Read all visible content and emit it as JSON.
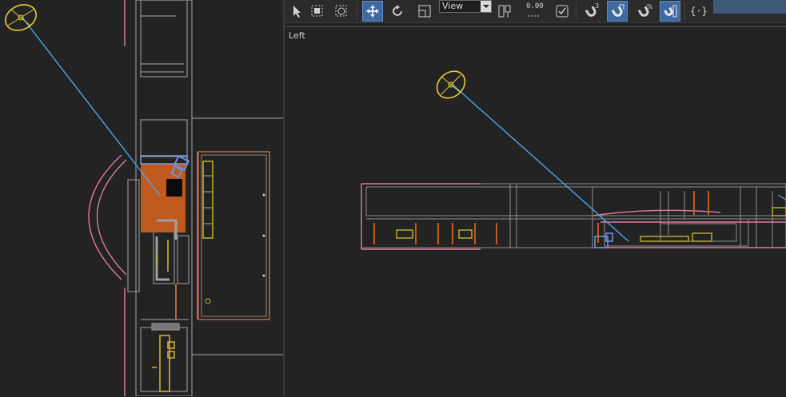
{
  "toolbar": {
    "view_dropdown": "View",
    "snap_spinner_value": "0.00",
    "snaps_toggle_sup": "3",
    "percent_snap_sup": "%",
    "named_selection_label": "{·}"
  },
  "viewports": {
    "right_label": "Left"
  },
  "colors": {
    "viewport_bg": "#232323",
    "active_button": "#3e6aa3",
    "light_gizmo": "#e6cc33",
    "target_line": "#4aa6e8",
    "wall_gray": "#9a9a9a",
    "floor_orange": "#c05a1f",
    "pink_lines": "#e07aa6",
    "furniture_yellow": "#c8b030"
  },
  "icons": [
    "select-object-icon",
    "region-select-icon",
    "lasso-select-icon",
    "move-icon",
    "rotate-icon",
    "scale-icon",
    "pivot-icon",
    "spinner-snap-icon",
    "mirror-icon",
    "snap-toggle-icon",
    "angle-snap-icon",
    "percent-snap-icon",
    "spinner-icon",
    "named-selection-icon"
  ]
}
